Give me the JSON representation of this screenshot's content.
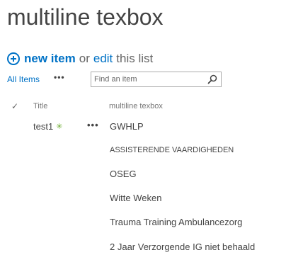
{
  "page": {
    "title": "multiline texbox"
  },
  "commands": {
    "new_item_label": "new item",
    "or_text": "or",
    "edit_label": "edit",
    "this_list_text": "this list"
  },
  "views": {
    "all_items_label": "All Items",
    "more_views_label": "•••",
    "search": {
      "placeholder": "Find an item",
      "value": ""
    }
  },
  "list": {
    "columns": {
      "select_glyph": "✓",
      "title": "Title",
      "multiline": "multiline texbox"
    },
    "items": [
      {
        "title": "test1",
        "new_badge": "✳",
        "menu_label": "•••",
        "multiline_lines": [
          "GWHLP",
          "ASSISTERENDE VAARDIGHEDEN",
          "OSEG",
          "Witte Weken",
          "Trauma Training Ambulancezorg",
          "2 Jaar Verzorgende IG niet behaald"
        ]
      }
    ]
  },
  "colors": {
    "accent": "#0072c6",
    "new_badge": "#6aab2e",
    "title_text": "#444444",
    "muted_text": "#666666"
  },
  "icons": {
    "add": "add-circle-icon",
    "search": "search-icon",
    "new": "new-item-star-icon",
    "check": "checkmark-icon"
  }
}
